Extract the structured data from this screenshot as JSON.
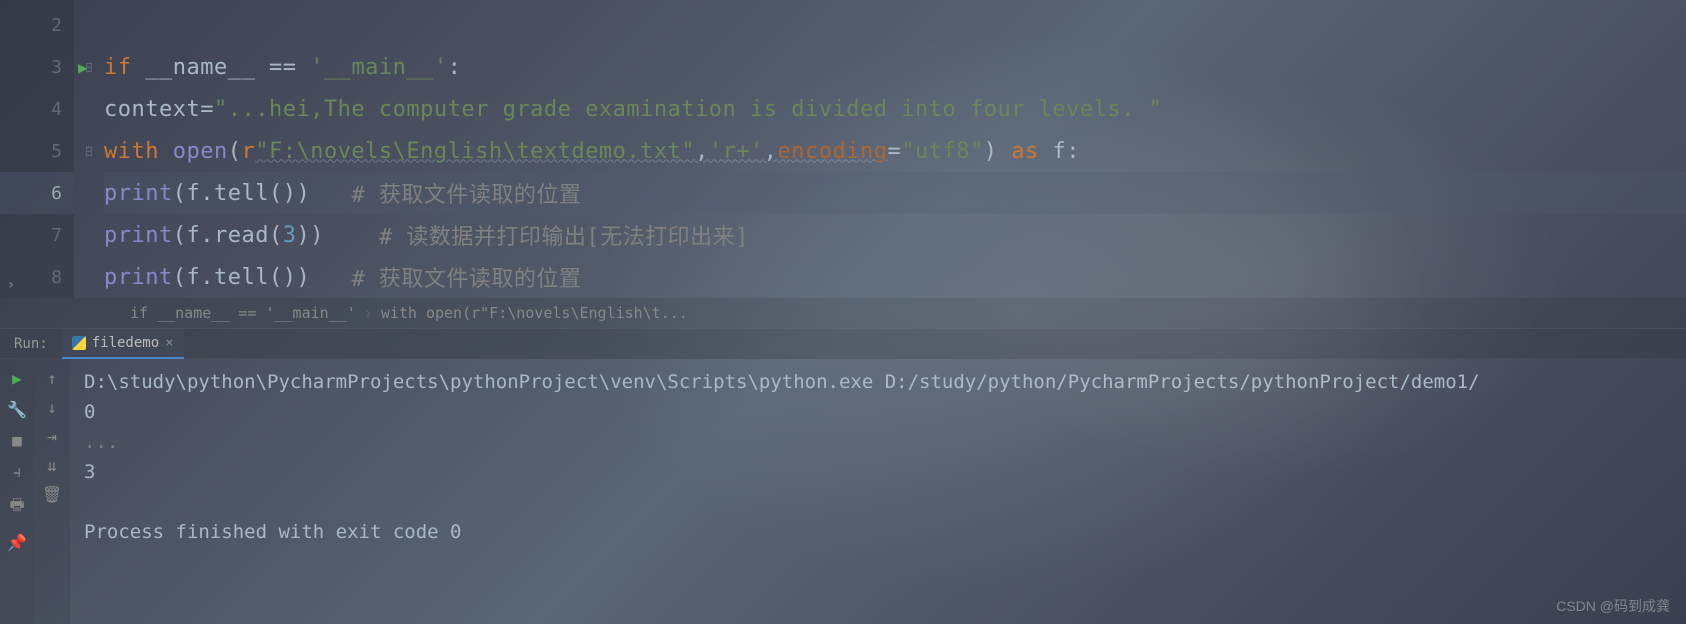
{
  "editor": {
    "lines": [
      {
        "num": "2"
      },
      {
        "num": "3"
      },
      {
        "num": "4"
      },
      {
        "num": "5"
      },
      {
        "num": "6",
        "active": true
      },
      {
        "num": "7"
      },
      {
        "num": "8"
      }
    ],
    "code": {
      "l3": {
        "kw1": "if",
        "var": " __name__ ",
        "op": "== ",
        "str": "'__main__'",
        "colon": ":"
      },
      "l4": {
        "var": "context",
        "op": "=",
        "str": "\"...hei,The computer grade examination is divided into four levels. \""
      },
      "l5": {
        "kw1": "with",
        "fn": " open",
        "p1": "(",
        "pre": "r",
        "str1": "\"F:\\novels\\English\\textdemo.txt\"",
        "c1": ",",
        "str2": "'r+'",
        "c2": ",",
        "param": "encoding",
        "eq": "=",
        "str3": "\"utf8\"",
        "p2": ") ",
        "kw2": "as",
        "var2": " f",
        "colon": ":"
      },
      "l6": {
        "fn": "print",
        "p1": "(",
        "var": "f.tell()",
        "p2": ")   ",
        "cm": "# 获取文件读取的位置"
      },
      "l7": {
        "fn": "print",
        "p1": "(",
        "var": "f.read(",
        "num": "3",
        "var2": ")",
        "p2": ")    ",
        "cm": "# 读数据并打印输出[无法打印出来]"
      },
      "l8": {
        "fn": "print",
        "p1": "(",
        "var": "f.tell()",
        "p2": ")   ",
        "cm": "# 获取文件读取的位置"
      }
    }
  },
  "breadcrumb": {
    "item1": "if __name__ == '__main__'",
    "item2": "with open(r\"F:\\novels\\English\\t..."
  },
  "run": {
    "label": "Run:",
    "tab": "filedemo",
    "output": {
      "l1": "D:\\study\\python\\PycharmProjects\\pythonProject\\venv\\Scripts\\python.exe D:/study/python/PycharmProjects/pythonProject/demo1/",
      "l2": "0",
      "l3": "...",
      "l4": "3",
      "l5": "",
      "l6": "Process finished with exit code 0"
    }
  },
  "watermark": "CSDN @码到成龚"
}
